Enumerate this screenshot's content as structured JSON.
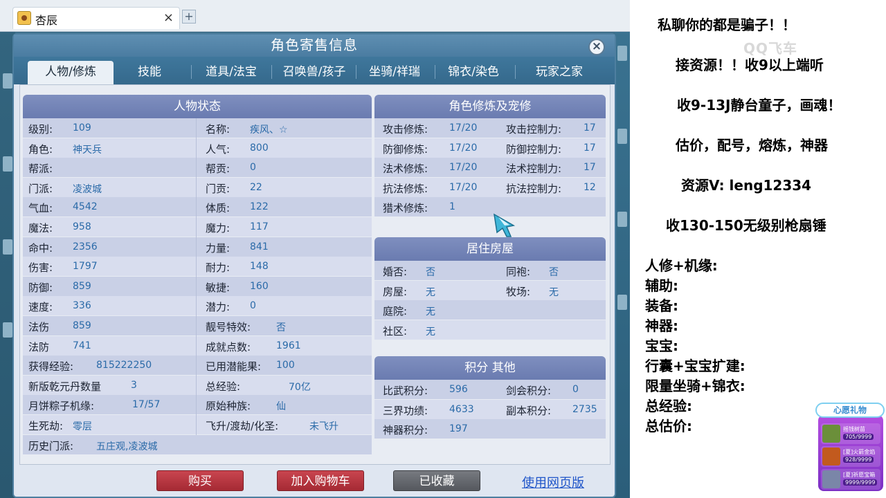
{
  "browser": {
    "tab_title": "杏辰",
    "tab_close": "×",
    "new_tab": "+"
  },
  "dialog": {
    "title": "角色寄售信息",
    "close": "×",
    "tabs": [
      "人物/修炼",
      "技能",
      "道具/法宝",
      "召唤兽/孩子",
      "坐骑/祥瑞",
      "锦衣/染色",
      "玩家之家"
    ],
    "active_tab": 0
  },
  "status": {
    "header": "人物状态",
    "rows": [
      {
        "l1": "级别:",
        "v1": "109",
        "l2": "名称:",
        "v2": "疾风、☆"
      },
      {
        "l1": "角色:",
        "v1": "神天兵",
        "l2": "人气:",
        "v2": "800"
      },
      {
        "l1": "帮派:",
        "v1": "",
        "l2": "帮贡:",
        "v2": "0"
      },
      {
        "l1": "门派:",
        "v1": "凌波城",
        "l2": "门贡:",
        "v2": "22"
      },
      {
        "l1": "气血:",
        "v1": "4542",
        "l2": "体质:",
        "v2": "122"
      },
      {
        "l1": "魔法:",
        "v1": "958",
        "l2": "魔力:",
        "v2": "117"
      },
      {
        "l1": "命中:",
        "v1": "2356",
        "l2": "力量:",
        "v2": "841"
      },
      {
        "l1": "伤害:",
        "v1": "1797",
        "l2": "耐力:",
        "v2": "148"
      },
      {
        "l1": "防御:",
        "v1": "859",
        "l2": "敏捷:",
        "v2": "160"
      },
      {
        "l1": "速度:",
        "v1": "336",
        "l2": "潜力:",
        "v2": "0"
      },
      {
        "l1": "法伤",
        "v1": "859",
        "l2": "靓号特效:",
        "v2": "否"
      },
      {
        "l1": "法防",
        "v1": "741",
        "l2": "成就点数:",
        "v2": "1961"
      },
      {
        "l1": "获得经验:",
        "v1": "815222250",
        "l2": "已用潜能果:",
        "v2": "100"
      },
      {
        "l1": "新版乾元丹数量",
        "v1": "3",
        "l2": "总经验:",
        "v2": "70亿"
      },
      {
        "l1": "月饼粽子机缘:",
        "v1": "17/57",
        "l2": "原始种族:",
        "v2": "仙"
      },
      {
        "l1": "生死劫:",
        "v1": "零层",
        "l2": "飞升/渡劫/化圣:",
        "v2": "未飞升"
      },
      {
        "l1": "历史门派:",
        "v1": "五庄观,凌波城",
        "l2": "",
        "v2": ""
      }
    ],
    "help": "?"
  },
  "cultivation": {
    "header": "角色修炼及宠修",
    "rows": [
      {
        "l1": "攻击修炼:",
        "v1": "17/20",
        "l2": "攻击控制力:",
        "v2": "17"
      },
      {
        "l1": "防御修炼:",
        "v1": "17/20",
        "l2": "防御控制力:",
        "v2": "17"
      },
      {
        "l1": "法术修炼:",
        "v1": "17/20",
        "l2": "法术控制力:",
        "v2": "17"
      },
      {
        "l1": "抗法修炼:",
        "v1": "17/20",
        "l2": "抗法控制力:",
        "v2": "12"
      },
      {
        "l1": "猎术修炼:",
        "v1": "1",
        "l2": "",
        "v2": ""
      }
    ]
  },
  "house": {
    "header": "居住房屋",
    "rows": [
      {
        "l1": "婚否:",
        "v1": "否",
        "l2": "同袍:",
        "v2": "否"
      },
      {
        "l1": "房屋:",
        "v1": "无",
        "l2": "牧场:",
        "v2": "无"
      },
      {
        "l1": "庭院:",
        "v1": "无",
        "l2": "",
        "v2": ""
      },
      {
        "l1": "社区:",
        "v1": "无",
        "l2": "",
        "v2": ""
      }
    ]
  },
  "points": {
    "header": "积分 其他",
    "rows": [
      {
        "l1": "比武积分:",
        "v1": "596",
        "l2": "剑会积分:",
        "v2": "0"
      },
      {
        "l1": "三界功绩:",
        "v1": "4633",
        "l2": "副本积分:",
        "v2": "2735"
      },
      {
        "l1": "神器积分:",
        "v1": "197",
        "l2": "",
        "v2": ""
      }
    ]
  },
  "footer": {
    "buy": "购买",
    "add_cart": "加入购物车",
    "favorited": "已收藏",
    "web": "使用网页版"
  },
  "stream": {
    "lines": [
      "私聊你的都是骗子！！",
      "接资源！！收9以上端听",
      "收9-13J静台童子，画魂！",
      "估价，配号，熔炼，神器",
      "资源V:  leng12334",
      "收130-150无级别枪扇锤",
      "人修+机缘:",
      "辅助:",
      "装备:",
      "神器:",
      "宝宝:",
      "行囊+宝宝扩建:",
      "限量坐骑+锦衣:",
      "总经验:",
      "总估价:"
    ],
    "watermark": "QQ飞车",
    "gift": {
      "banner": "心愿礼物",
      "items": [
        {
          "name": "摇钱树苗",
          "count": "705/9999",
          "color": "#6b8f3a"
        },
        {
          "name": "[夏]火箭金焰",
          "count": "928/9999",
          "color": "#c25a1e"
        },
        {
          "name": "[夏]祈愿宝箱",
          "count": "9999/9999",
          "color": "#7a86a8"
        }
      ]
    }
  }
}
